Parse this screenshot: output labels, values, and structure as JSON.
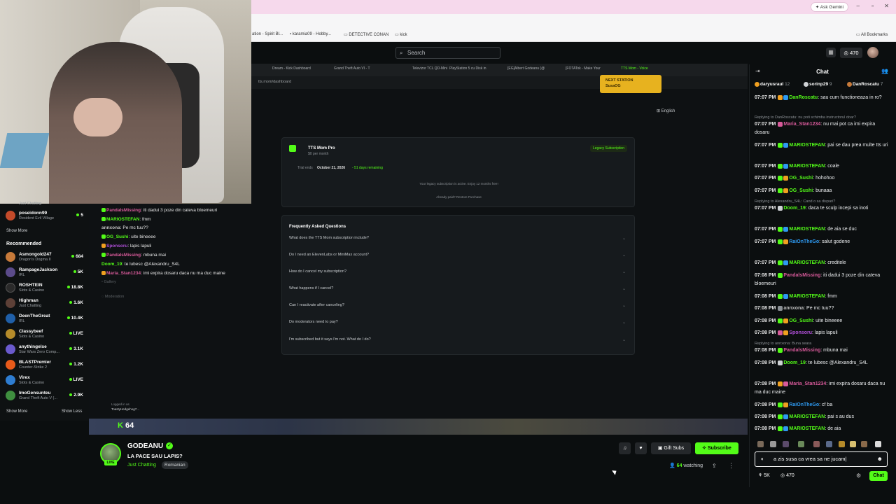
{
  "browser": {
    "gemini_label": "Ask Gemini",
    "bookmarks": [
      "ation - Spirit Bl...",
      "karamia09 - Hobby...",
      "DETECTIVE CONAN",
      "kick"
    ],
    "all_bookmarks": "All Bookmarks"
  },
  "topbar": {
    "search_placeholder": "Search",
    "points": "470"
  },
  "sidebar": {
    "partial_top": "Just Chatting",
    "followed": [
      {
        "name": "poseidonn99",
        "category": "Resident Evil Village",
        "count": "5",
        "color": "#c44a2a"
      }
    ],
    "show_more_1": "Show More",
    "recommended_heading": "Recommended",
    "recommended": [
      {
        "name": "Asmongold247",
        "category": "Dragon's Dogma II",
        "count": "684",
        "color": "#c77a3a"
      },
      {
        "name": "RampageJackson",
        "category": "IRL",
        "count": "5K",
        "color": "#5b4b8a"
      },
      {
        "name": "ROSHTEIN",
        "category": "Slots & Casino",
        "count": "18.8K",
        "color": "#2a2a2a"
      },
      {
        "name": "Highman",
        "category": "Just Chatting",
        "count": "1.6K",
        "color": "#5d4037"
      },
      {
        "name": "DeenTheGreat",
        "category": "IRL",
        "count": "10.4K",
        "color": "#1f5fa8"
      },
      {
        "name": "Classybeef",
        "category": "Slots & Casino",
        "count": "LIVE",
        "color": "#b58b2a"
      },
      {
        "name": "anythingelse",
        "category": "Star Wars Zero Comp...",
        "count": "3.1K",
        "color": "#6a5acd"
      },
      {
        "name": "BLASTPremier",
        "category": "Counter-Strike 2",
        "count": "1.2K",
        "color": "#e85a1a"
      },
      {
        "name": "Virex",
        "category": "Slots & Casino",
        "count": "LIVE",
        "color": "#2e7dd1"
      },
      {
        "name": "ImoGensunteu",
        "category": "Grand Theft Auto V (...",
        "count": "2.9K",
        "color": "#3f8f3f"
      }
    ],
    "show_more_2": "Show More",
    "show_less": "Show Less"
  },
  "screen": {
    "tabs": [
      "Dream - Kick Dashboard",
      "Grand Theft Auto VI - T",
      "Televizor TCL QD-Mini",
      "PlayStation 5 cu Disk in",
      "[EG]Albert Godeanu (@",
      "[FOTATok - Make Your",
      "TTS Mom - Voice"
    ],
    "address": "tts.mom/dashboard",
    "next_station_label": "NEXT STATION",
    "next_station_value": "SusaOG",
    "language": "English",
    "plan_name": "TTS Mom Pro",
    "plan_price": "$0 per month",
    "plan_badge": "Legacy Subscription",
    "trial_label": "Trial ends",
    "trial_date": "October 21, 2026",
    "trial_remaining": "- 51 days remaining",
    "legacy_note": "Your legacy subscription is active. Enjoy 12 months free!",
    "already_paid": "Already paid? Restore Purchase",
    "faq_heading": "Frequently Asked Questions",
    "faq": [
      "What does the TTS Mom subscription include?",
      "Do I need an ElevenLabs or MiniMax account?",
      "How do I cancel my subscription?",
      "What happens if I cancel?",
      "Can I reactivate after canceling?",
      "Do moderators need to pay?",
      "I'm subscribed but it says I'm not. What do I do?"
    ],
    "gallery": "Gallery",
    "moderation": "Moderation",
    "logged_in": "Logged in as",
    "logged_user": "ToastyHedgehog7...",
    "kick_viewers": "64",
    "mini_chat": [
      {
        "user": "PandalsMissing",
        "text": "iti dadui 3 poze din cateva bloemeuri",
        "color": "#d85a9a"
      },
      {
        "user": "MARIOSTEFAN",
        "text": "fmm",
        "color": "#53fc18"
      },
      {
        "user": "annxona",
        "text": "Pe mc tuu??",
        "color": "#bfbfbf"
      },
      {
        "user": "OG_Sushi",
        "text": "uite bineeee",
        "color": "#53fc18"
      },
      {
        "user": "Sponsoru",
        "text": "lapis lapuli",
        "color": "#b04fd8"
      },
      {
        "user": "PandalsMissing",
        "text": "mbuna mai",
        "color": "#d85a9a"
      },
      {
        "user": "Doom_19",
        "text": "te lubesc @Alexandru_S4L",
        "color": "#53fc18"
      },
      {
        "user": "Maria_Stan1234",
        "text": "imi expira dosaru daca nu ma duc maine",
        "color": "#d85a9a"
      }
    ]
  },
  "channel": {
    "name": "GODEANU",
    "title": "LA PACE SAU LAPIS?",
    "category": "Just Chatting",
    "language": "Romanian",
    "live": "LIVE",
    "gift_subs": "Gift Subs",
    "subscribe": "Subscribe",
    "viewers": "64",
    "viewers_suffix": "watching"
  },
  "chat": {
    "title": "Chat",
    "gifters": [
      {
        "name": "daryusraul",
        "count": "12"
      },
      {
        "name": "sorinp29",
        "count": "9"
      },
      {
        "name": "DanRoscatu",
        "count": "7"
      }
    ],
    "messages": [
      {
        "time": "07:07 PM",
        "user": "DanRoscatu",
        "text": "sau cum functioneaza in ro?",
        "color": "#53fc18",
        "reply": ""
      },
      {
        "time": "07:07 PM",
        "user": "Maria_Stan1234",
        "text": "nu mai pot ca imi expira dosaru",
        "color": "#d85a9a",
        "reply": "Replying to DanRoscatu: nu poti schimba instructorul doar?"
      },
      {
        "time": "07:07 PM",
        "user": "MARIOSTEFAN",
        "text": "pai se dau prea multe tts uri",
        "color": "#53fc18",
        "reply": ""
      },
      {
        "time": "07:07 PM",
        "user": "MARIOSTEFAN",
        "text": "coale",
        "color": "#53fc18",
        "reply": ""
      },
      {
        "time": "07:07 PM",
        "user": "OG_Sushi",
        "text": "hohohoo",
        "color": "#53fc18",
        "reply": ""
      },
      {
        "time": "07:07 PM",
        "user": "OG_Sushi",
        "text": "bunaaa",
        "color": "#53fc18",
        "reply": ""
      },
      {
        "time": "07:07 PM",
        "user": "Doom_19",
        "text": "daca te sculp incepi sa inoti",
        "color": "#53fc18",
        "reply": "Replying to Alexandru_S4L: Cand o sa dispari?"
      },
      {
        "time": "07:07 PM",
        "user": "MARIOSTEFAN",
        "text": "de aia se duc",
        "color": "#53fc18",
        "reply": ""
      },
      {
        "time": "07:07 PM",
        "user": "RaiOnTheGo",
        "text": "salut godene",
        "color": "#2e9af2",
        "reply": ""
      },
      {
        "time": "07:07 PM",
        "user": "MARIOSTEFAN",
        "text": "creditele",
        "color": "#53fc18",
        "reply": ""
      },
      {
        "time": "07:08 PM",
        "user": "PandalsMissing",
        "text": "iti dadui 3 poze din cateva bloemeuri",
        "color": "#d85a9a",
        "reply": ""
      },
      {
        "time": "07:08 PM",
        "user": "MARIOSTEFAN",
        "text": "fmm",
        "color": "#53fc18",
        "reply": ""
      },
      {
        "time": "07:08 PM",
        "user": "annxona",
        "text": "Pe mc tuu??",
        "color": "#bfbfbf",
        "reply": ""
      },
      {
        "time": "07:08 PM",
        "user": "OG_Sushi",
        "text": "uite bineeee",
        "color": "#53fc18",
        "reply": ""
      },
      {
        "time": "07:08 PM",
        "user": "Sponsoru",
        "text": "lapis lapuli",
        "color": "#b04fd8",
        "reply": ""
      },
      {
        "time": "07:08 PM",
        "user": "PandalsMissing",
        "text": "mbuna mai",
        "color": "#d85a9a",
        "reply": "Replying to annxona: Buna seara"
      },
      {
        "time": "07:08 PM",
        "user": "Doom_19",
        "text": "te lubesc @Alexandru_S4L",
        "color": "#53fc18",
        "reply": ""
      },
      {
        "time": "07:08 PM",
        "user": "Maria_Stan1234",
        "text": "imi expira dosaru daca nu ma duc maine",
        "color": "#d85a9a",
        "reply": ""
      },
      {
        "time": "07:08 PM",
        "user": "RaiOnTheGo",
        "text": "cf ba",
        "color": "#2e9af2",
        "reply": ""
      },
      {
        "time": "07:08 PM",
        "user": "MARIOSTEFAN",
        "text": "pai s au dus",
        "color": "#53fc18",
        "reply": ""
      },
      {
        "time": "07:08 PM",
        "user": "MARIOSTEFAN",
        "text": "de aia",
        "color": "#53fc18",
        "reply": ""
      }
    ],
    "input_value": "a zis susa ca vrea sa ne jucam",
    "footer_count": "5K",
    "footer_points": "470",
    "send": "Chat"
  }
}
